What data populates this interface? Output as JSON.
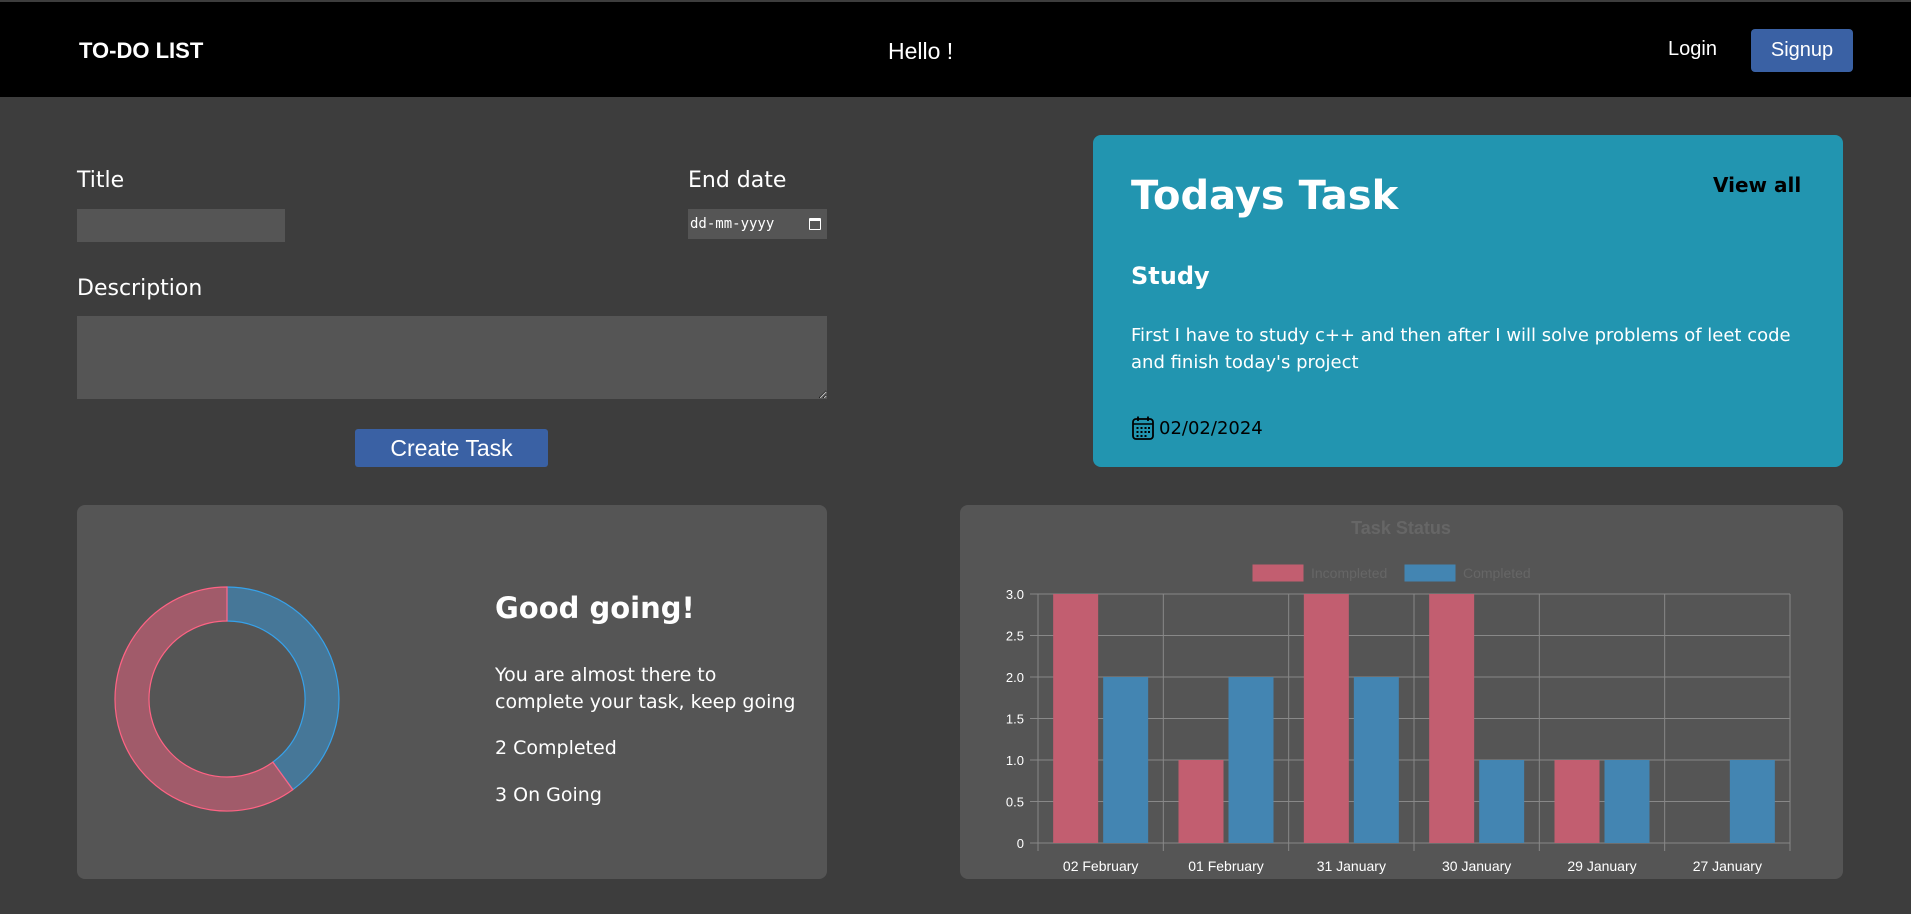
{
  "navbar": {
    "brand": "TO-DO LIST",
    "greeting": "Hello !",
    "login_label": "Login",
    "signup_label": "Signup"
  },
  "form": {
    "title_label": "Title",
    "title_value": "",
    "end_date_label": "End date",
    "end_date_placeholder": "dd-mm-yyyy",
    "description_label": "Description",
    "description_value": "",
    "create_button_label": "Create Task"
  },
  "today": {
    "heading": "Todays Task",
    "view_all_label": "View all",
    "task_title": "Study",
    "task_description": "First I have to study c++ and then after I will solve problems of leet code and finish today's project",
    "task_date": "02/02/2024",
    "date_icon": "calendar-icon"
  },
  "status": {
    "heading": "Good going!",
    "message": "You are almost there to complete your task, keep going",
    "completed_text": "2 Completed",
    "ongoing_text": "3 On Going",
    "donut": {
      "completed": 2,
      "ongoing": 3,
      "completed_color": "#36a2eb",
      "ongoing_color": "#ff6384"
    }
  },
  "chart_data": {
    "type": "bar",
    "title": "Task Status",
    "categories": [
      "02 February",
      "01 February",
      "31 January",
      "30 January",
      "29 January",
      "27 January"
    ],
    "series": [
      {
        "name": "Incompleted",
        "values": [
          3,
          1,
          3,
          3,
          1,
          0
        ],
        "color": "#c25e70"
      },
      {
        "name": "Completed",
        "values": [
          2,
          2,
          2,
          1,
          1,
          1
        ],
        "color": "#4385b2"
      }
    ],
    "ylim": [
      0,
      3.0
    ],
    "yticks": [
      "0",
      "0.5",
      "1.0",
      "1.5",
      "2.0",
      "2.5",
      "3.0"
    ],
    "grid": true,
    "legend": "top"
  }
}
